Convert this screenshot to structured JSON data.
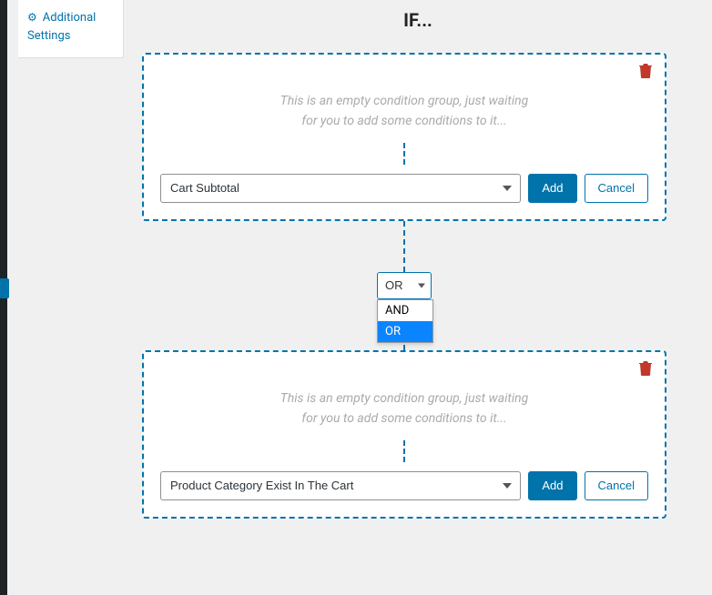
{
  "sidebar": {
    "item_label": "Additional Settings"
  },
  "heading": "IF...",
  "empty_text_line1": "This is an empty condition group, just waiting",
  "empty_text_line2": "for you to add some conditions to it...",
  "groups": [
    {
      "select_value": "Cart Subtotal",
      "add_label": "Add",
      "cancel_label": "Cancel"
    },
    {
      "select_value": "Product Category Exist In The Cart",
      "add_label": "Add",
      "cancel_label": "Cancel"
    }
  ],
  "logic": {
    "selected": "OR",
    "options": [
      "AND",
      "OR"
    ]
  }
}
